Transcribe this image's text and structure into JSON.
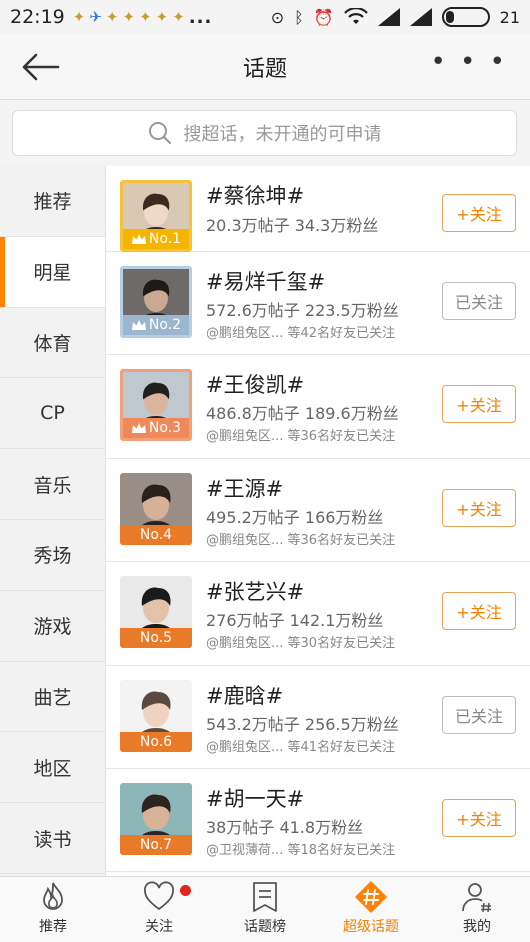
{
  "status_bar": {
    "time": "22:19",
    "dots": "...",
    "battery_level": "21",
    "battery_fraction": 0.21
  },
  "header": {
    "title": "话题",
    "more": "• • •"
  },
  "search": {
    "placeholder": "搜超话，未开通的可申请"
  },
  "sidebar": {
    "items": [
      {
        "label": "推荐",
        "active": false
      },
      {
        "label": "明星",
        "active": true
      },
      {
        "label": "体育",
        "active": false
      },
      {
        "label": "CP",
        "active": false
      },
      {
        "label": "音乐",
        "active": false
      },
      {
        "label": "秀场",
        "active": false
      },
      {
        "label": "游戏",
        "active": false
      },
      {
        "label": "曲艺",
        "active": false
      },
      {
        "label": "地区",
        "active": false
      },
      {
        "label": "读书",
        "active": false
      }
    ]
  },
  "topics": [
    {
      "rank": "No.1",
      "title": "#蔡徐坤#",
      "stats": "20.3万帖子  34.3万粉丝",
      "friends": "",
      "button": "+关注",
      "followed": false,
      "rank_color": "#f5b400",
      "frame_color": "#f5c33b"
    },
    {
      "rank": "No.2",
      "title": "#易烊千玺#",
      "stats": "572.6万帖子  223.5万粉丝",
      "friends": "@鹏组兔区...  等42名好友已关注",
      "button": "已关注",
      "followed": true,
      "rank_color": "#9bb6cf",
      "frame_color": "#b9cde0"
    },
    {
      "rank": "No.3",
      "title": "#王俊凯#",
      "stats": "486.8万帖子  189.6万粉丝",
      "friends": "@鹏组兔区...  等36名好友已关注",
      "button": "+关注",
      "followed": false,
      "rank_color": "#ee8a5a",
      "frame_color": "#f1a07a"
    },
    {
      "rank": "No.4",
      "title": "#王源#",
      "stats": "495.2万帖子  166万粉丝",
      "friends": "@鹏组兔区...  等36名好友已关注",
      "button": "+关注",
      "followed": false,
      "rank_color": "#e87a28",
      "frame_color": ""
    },
    {
      "rank": "No.5",
      "title": "#张艺兴#",
      "stats": "276万帖子  142.1万粉丝",
      "friends": "@鹏组兔区...  等30名好友已关注",
      "button": "+关注",
      "followed": false,
      "rank_color": "#e87a28",
      "frame_color": ""
    },
    {
      "rank": "No.6",
      "title": "#鹿晗#",
      "stats": "543.2万帖子  256.5万粉丝",
      "friends": "@鹏组兔区...  等41名好友已关注",
      "button": "已关注",
      "followed": true,
      "rank_color": "#e87a28",
      "frame_color": ""
    },
    {
      "rank": "No.7",
      "title": "#胡一天#",
      "stats": "38万帖子  41.8万粉丝",
      "friends": "@卫视薄荷...  等18名好友已关注",
      "button": "+关注",
      "followed": false,
      "rank_color": "#e87a28",
      "frame_color": ""
    }
  ],
  "tabbar": {
    "items": [
      {
        "label": "推荐",
        "icon": "flame-icon",
        "active": false
      },
      {
        "label": "关注",
        "icon": "heart-icon",
        "active": false,
        "badge": true
      },
      {
        "label": "话题榜",
        "icon": "list-badge-icon",
        "active": false
      },
      {
        "label": "超级话题",
        "icon": "hashtag-icon",
        "active": true
      },
      {
        "label": "我的",
        "icon": "person-hashtag-icon",
        "active": false
      }
    ]
  },
  "colors": {
    "accent": "#ff8200",
    "follow_text": "#f08300",
    "followed_text": "#888888",
    "badge_red": "#e0251b"
  }
}
